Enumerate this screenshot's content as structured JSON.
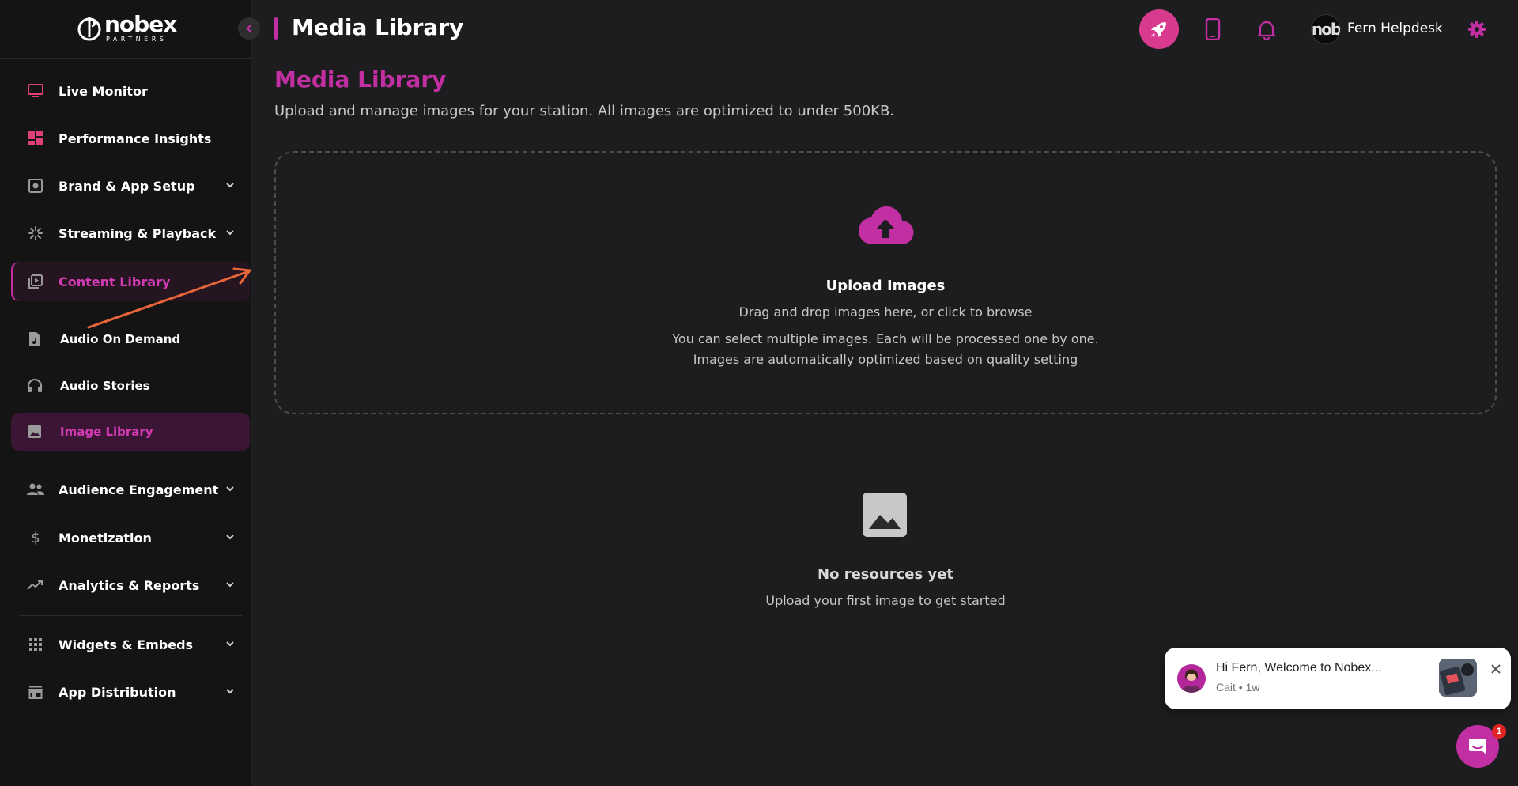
{
  "brand": {
    "word": "nobex",
    "sub": "PARTNERS",
    "accent": "#c12fa2"
  },
  "sidebar": {
    "collapse_icon": "chevron-left-icon",
    "items": [
      {
        "label": "Live Monitor",
        "icon": "monitor-icon"
      },
      {
        "label": "Performance Insights",
        "icon": "dashboard-icon"
      },
      {
        "label": "Brand & App Setup",
        "icon": "palette-icon"
      },
      {
        "label": "Streaming & Playback",
        "icon": "sparkle-icon"
      },
      {
        "label": "Content Library",
        "icon": "video-library-icon"
      },
      {
        "label": "Audience Engagement",
        "icon": "people-icon"
      },
      {
        "label": "Monetization",
        "icon": "dollar-icon"
      },
      {
        "label": "Analytics & Reports",
        "icon": "trending-up-icon"
      },
      {
        "label": "Widgets & Embeds",
        "icon": "grid-icon"
      },
      {
        "label": "App Distribution",
        "icon": "store-icon"
      }
    ],
    "subitems": [
      {
        "label": "Audio On Demand",
        "icon": "audio-file-icon"
      },
      {
        "label": "Audio Stories",
        "icon": "headphones-icon"
      },
      {
        "label": "Image Library",
        "icon": "image-icon"
      }
    ]
  },
  "header": {
    "title": "Media Library",
    "user_name": "Fern Helpdesk",
    "avatar_text": "nob"
  },
  "main": {
    "heading": "Media Library",
    "description": "Upload and manage images for your station. All images are optimized to under 500KB.",
    "upload": {
      "title": "Upload Images",
      "subtitle": "Drag and drop images here, or click to browse",
      "note1": "You can select multiple images. Each will be processed one by one.",
      "note2": "Images are automatically optimized based on quality setting"
    },
    "empty": {
      "title": "No resources yet",
      "subtitle": "Upload your first image to get started"
    }
  },
  "chat": {
    "message": "Hi Fern, Welcome to Nobex...",
    "meta": "Cait • 1w",
    "badge": "1"
  }
}
